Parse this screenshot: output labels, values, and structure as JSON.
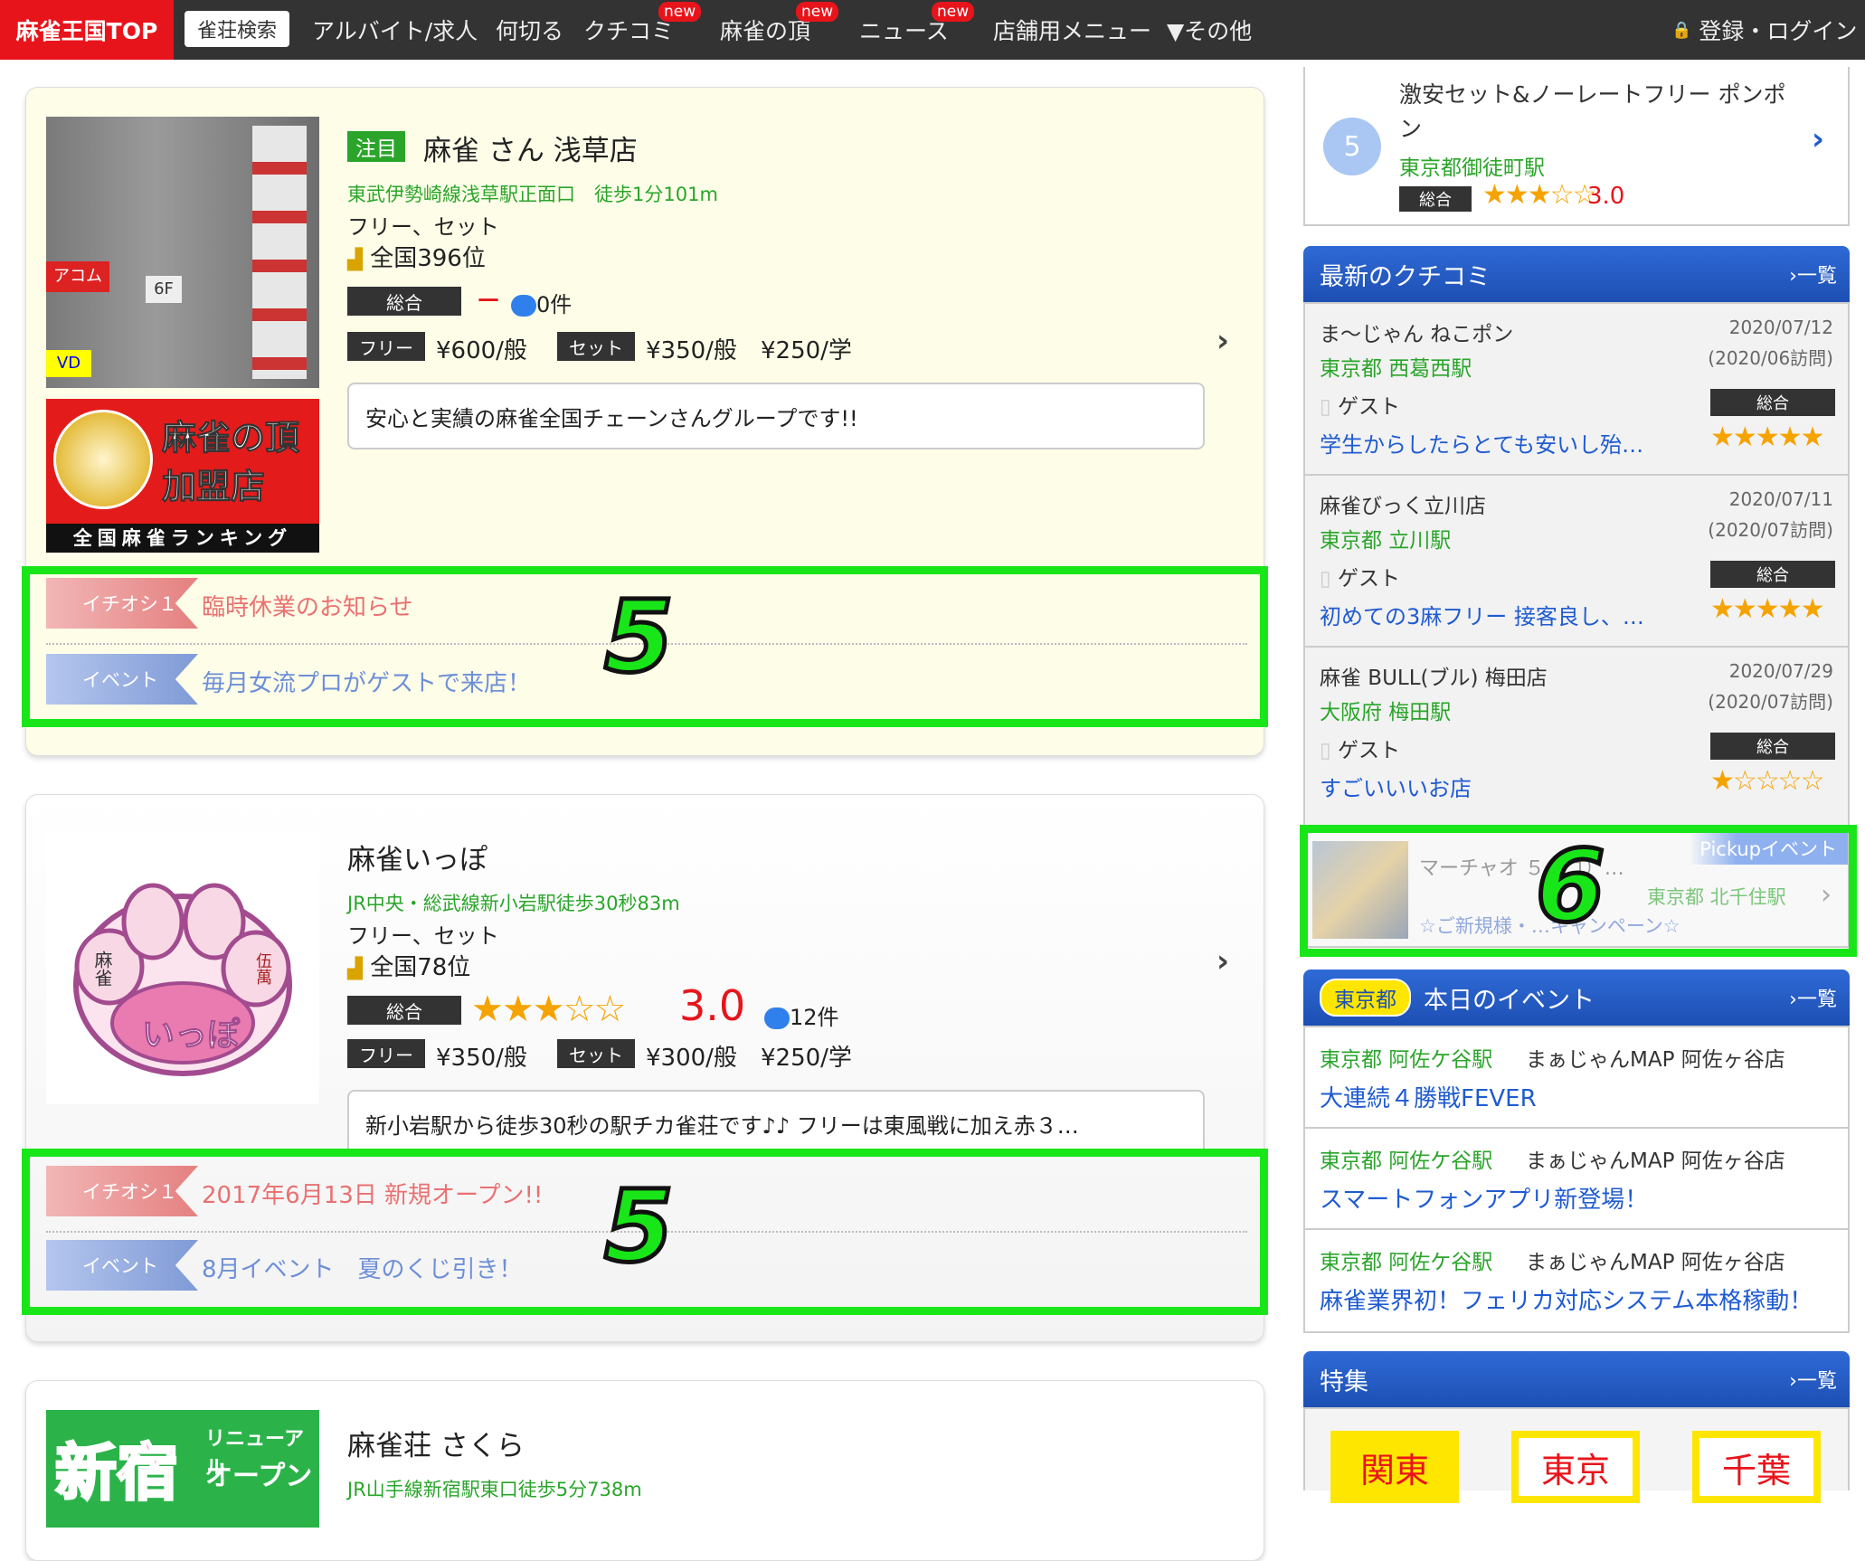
{
  "nav": {
    "home": "麻雀王国TOP",
    "search": "雀荘検索",
    "items": [
      "アルバイト/求人",
      "何切る",
      "クチコミ",
      "麻雀の頂",
      "ニュース",
      "店舗用メニュー",
      "▼その他"
    ],
    "new_badge": "new",
    "login": "登録・ログイン"
  },
  "shops": [
    {
      "badge": "注目",
      "name": "麻雀 さん 浅草店",
      "station": "東武伊勢崎線浅草駅正面口　徒歩1分101m",
      "type": "フリー、セット",
      "rank": "全国396位",
      "overall_label": "総合",
      "rating_dash": "－",
      "comments": "0件",
      "free_label": "フリー",
      "free_price": "¥600/般",
      "set_label": "セット",
      "set_price": "¥350/般",
      "student_price": "¥250/学",
      "description": "安心と実績の麻雀全国チェーンさんグループです!!",
      "banner_title_1": "麻雀の頂",
      "banner_title_2": "加盟店",
      "banner_sub": "全国麻雀ランキング",
      "photo_sign_1": "アコム",
      "photo_sign_2": "6F",
      "photo_sign_3": "VD",
      "tag1_label": "イチオシ１",
      "tag1_text": "臨時休業のお知らせ",
      "tag2_label": "イベント",
      "tag2_text": "毎月女流プロがゲストで来店！",
      "annotation": "5"
    },
    {
      "name": "麻雀いっぽ",
      "station": "JR中央・総武線新小岩駅徒歩30秒83m",
      "type": "フリー、セット",
      "rank": "全国78位",
      "overall_label": "総合",
      "stars": "★★★☆☆",
      "rating": "3.0",
      "rating_value": 3.0,
      "comments": "12件",
      "free_label": "フリー",
      "free_price": "¥350/般",
      "set_label": "セット",
      "set_price": "¥300/般",
      "student_price": "¥250/学",
      "description": "新小岩駅から徒歩30秒の駅チカ雀荘です♪♪ フリーは東風戦に加え赤３…",
      "logo_text": "いっぽ",
      "logo_tile_1": "麻雀",
      "logo_tile_2": "伍萬",
      "tag1_label": "イチオシ１",
      "tag1_text": "2017年6月13日 新規オープン!!",
      "tag2_label": "イベント",
      "tag2_text": "8月イベント　夏のくじ引き！",
      "annotation": "5"
    },
    {
      "name": "麻雀荘 さくら",
      "station": "JR山手線新宿駅東口徒歩5分738m",
      "banner_big": "新宿",
      "banner_small_1": "リニューアル",
      "banner_small_2": "オープン"
    }
  ],
  "ranking_item": {
    "number": "5",
    "name": "激安セット&ノーレートフリー ポンポン",
    "station": "東京都御徒町駅",
    "overall_label": "総合",
    "stars": "★★★☆☆",
    "rating": "3.0",
    "rating_value": 3.0
  },
  "reviews": {
    "title": "最新のクチコミ",
    "more": "一覧",
    "items": [
      {
        "shop": "ま～じゃん ねこポン",
        "station": "東京都 西葛西駅",
        "date": "2020/07/12",
        "visit": "(2020/06訪問)",
        "user": "ゲスト",
        "overall_label": "総合",
        "stars": "★★★★★",
        "rating_value": 5,
        "text": "学生からしたらとても安いし殆…"
      },
      {
        "shop": "麻雀びっく立川店",
        "station": "東京都 立川駅",
        "date": "2020/07/11",
        "visit": "(2020/07訪問)",
        "user": "ゲスト",
        "overall_label": "総合",
        "stars": "★★★★★",
        "rating_value": 5,
        "text": "初めての3麻フリー 接客良し、…"
      },
      {
        "shop": "麻雀 BULL(ブル) 梅田店",
        "station": "大阪府 梅田駅",
        "date": "2020/07/29",
        "visit": "(2020/07訪問)",
        "user": "ゲスト",
        "overall_label": "総合",
        "stars": "★☆☆☆☆",
        "rating_value": 1,
        "text": "すごいいいお店"
      }
    ]
  },
  "pickup": {
    "label": "Pickupイベント",
    "shop": "マーチャオ ５（ゴ）…",
    "station": "東京都 北千住駅",
    "text": "☆ご新規様・…キャンペーン☆",
    "annotation": "6"
  },
  "events": {
    "region": "東京都",
    "title": "本日のイベント",
    "more": "一覧",
    "items": [
      {
        "station": "東京都 阿佐ケ谷駅",
        "shop": "まぁじゃんMAP 阿佐ヶ谷店",
        "text": "大連続４勝戦FEVER"
      },
      {
        "station": "東京都 阿佐ケ谷駅",
        "shop": "まぁじゃんMAP 阿佐ヶ谷店",
        "text": "スマートフォンアプリ新登場！"
      },
      {
        "station": "東京都 阿佐ケ谷駅",
        "shop": "まぁじゃんMAP 阿佐ヶ谷店",
        "text": "麻雀業界初！フェリカ対応システム本格稼動！"
      }
    ]
  },
  "features": {
    "title": "特集",
    "more": "一覧",
    "tiles": [
      "関東",
      "東京",
      "千葉"
    ]
  },
  "colors": {
    "brand_red": "#e8141b",
    "nav_bg": "#333333",
    "highlight_green": "#19e619",
    "station_green": "#2aa52a",
    "link_blue": "#1f5bd1",
    "panel_blue": "#1d4fb3",
    "card1_bg": "#fefee8"
  }
}
